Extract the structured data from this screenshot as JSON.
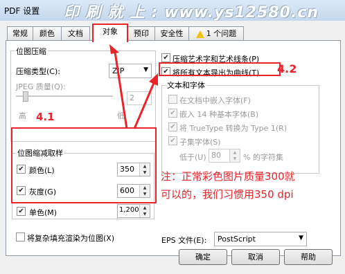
{
  "window": {
    "title": "PDF 设置",
    "watermark": "印 刷 就 上 : www.ys12580.cn"
  },
  "tabs": [
    {
      "label": "常规"
    },
    {
      "label": "颜色"
    },
    {
      "label": "文档"
    },
    {
      "label": "对象"
    },
    {
      "label": "预印"
    },
    {
      "label": "安全性"
    },
    {
      "label": "1 个问题"
    }
  ],
  "bitmap_compression": {
    "title": "位图压缩",
    "type_label": "压缩类型(C):",
    "type_value": "ZIP",
    "jpeg_quality_label": "JPEG 质量(Q):",
    "jpeg_quality_value": "2",
    "slider_high": "高",
    "slider_low": "低"
  },
  "downsampling": {
    "title": "位图缩减取样",
    "items": [
      {
        "label": "颜色(L)",
        "value": "350",
        "checked": "✔"
      },
      {
        "label": "灰度(G)",
        "value": "600",
        "checked": "✔"
      },
      {
        "label": "单色(M)",
        "value": "1,200",
        "checked": "✔"
      }
    ]
  },
  "render_complex": {
    "label": "将复杂填充渲染为位图(X)"
  },
  "compress_art": {
    "label": "压缩艺术字和艺术线条(P)",
    "checked": "✔"
  },
  "export_curves": {
    "label": "将所有文本导出为曲线(T)",
    "checked": "✔"
  },
  "text_fonts": {
    "title": "文本和字体",
    "embed": "在文档中嵌入字体(F)",
    "base14": "嵌入 14 种基本字体(B)",
    "truetype": "将 TrueType 转换为 Type 1(R)",
    "subset": "子集字体(S)",
    "below_label": "低于(U)",
    "below_value": "80",
    "below_suffix": "% 的字符集"
  },
  "eps": {
    "label": "EPS 文件(E):",
    "value": "PostScript"
  },
  "buttons": {
    "ok": "确定",
    "cancel": "取消",
    "help": "帮助"
  },
  "annotations": {
    "label41": "4.1",
    "label42": "4.2",
    "note_line1": "注：正常彩色图片质量300就",
    "note_line2": "可以的，我们习惯用350 dpi"
  },
  "colors": {
    "accent_red": "#e8232a",
    "title_bar": "#c4d7ee"
  }
}
